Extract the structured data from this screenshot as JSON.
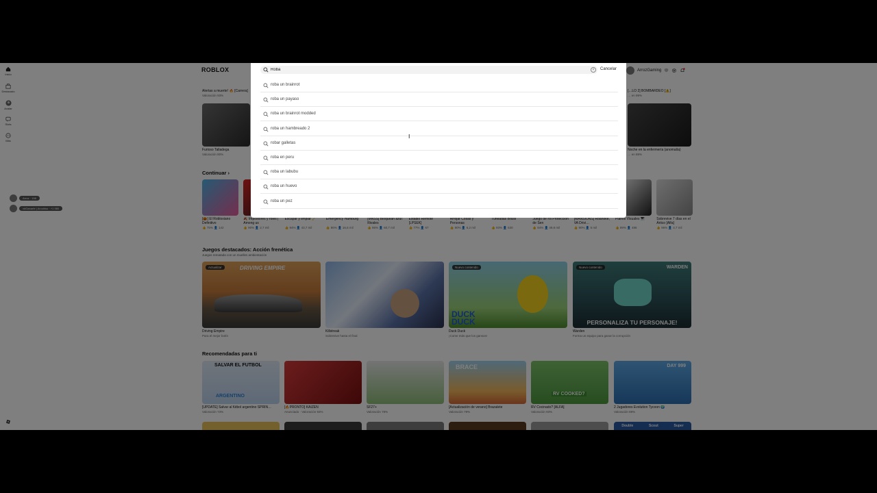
{
  "brand": {
    "logo": "ROBLOX"
  },
  "nav": {
    "items": [
      {
        "label": "Inicio"
      },
      {
        "label": "Destacado"
      },
      {
        "label": "Avatar"
      },
      {
        "label": "Slots"
      },
      {
        "label": "Más"
      }
    ]
  },
  "header": {
    "username": "ArrozGaming"
  },
  "friends": [
    {
      "name": "Arroz",
      "count": "198"
    },
    {
      "name": "xdGanarfe | Arcoiriso",
      "count": "+1 980"
    }
  ],
  "top_row": {
    "items": [
      {
        "name": "Alertas a muerte! 🔥 [Carrera]",
        "meta": "Valoración 93%"
      },
      {
        "name": "[…LO 2] BOMBARDEO [⚠️]",
        "meta": "… en 99%"
      }
    ]
  },
  "row2": {
    "items": [
      {
        "name": "Furioso Talladega",
        "meta": "Valoración 80%"
      },
      {
        "name": "Noche en la enfermería (anomalía)",
        "meta": "… en 89%"
      }
    ]
  },
  "continuar": {
    "title": "Continuar",
    "items": [
      {
        "name": "[🎃] El Robloxiano Definitivo",
        "rating": "75%",
        "players": "142"
      },
      {
        "name": "🍂 Impostores y roles | Among us",
        "rating": "90%",
        "players": "2,7 mil"
      },
      {
        "name": "Escapar y limpiar 🧹",
        "rating": "94%",
        "players": "43,7 mil"
      },
      {
        "name": "Emergency Hamburg",
        "rating": "86%",
        "players": "16,6 mil"
      },
      {
        "name": "[MNSS] Bloquean azul: Rivales",
        "rating": "96%",
        "players": "60,7 mil"
      },
      {
        "name": "Estadio Remote [LPSEK]",
        "rating": "77%",
        "players": "67"
      },
      {
        "name": "Arrojar Cosas y Personas",
        "rating": "90%",
        "players": "6,2 mil"
      },
      {
        "name": "Tuneadas Brasil",
        "rating": "93%",
        "players": "630"
      },
      {
        "name": "Juego de rol Protección de Sen",
        "rating": "84%",
        "players": "49,8 mil"
      },
      {
        "name": "[MANSIONS] Roanoke, VA Drivi…",
        "rating": "90%",
        "players": "5 mil"
      },
      {
        "name": "Pianos Visuales 🎹",
        "rating": "89%",
        "players": "486"
      },
      {
        "name": "Sobrevive 7 días en el Ártico [Alfa]",
        "rating": "96%",
        "players": "4,7 mil"
      }
    ]
  },
  "featured": {
    "title": "Juegos destacados: Acción frenética",
    "subtitle": "Juegos rematada con un muelles ambientación",
    "items": [
      {
        "badge": "Actualizar",
        "name": "Driving Empire",
        "desc": "Para el mejor botín",
        "art": "DRIVING EMPIRE"
      },
      {
        "badge": "",
        "name": "Killstreak",
        "desc": "Sobrevive hasta el final",
        "art": ""
      },
      {
        "badge": "Nuevo contenido",
        "name": "Duck Duck",
        "desc": "¡Come más que los gansos!",
        "art": "DUCK DUCK"
      },
      {
        "badge": "Nuevo contenido",
        "name": "Warden",
        "desc": "Forma un equipo para ganar la corrupción",
        "art": "PERSONALIZA TU PERSONAJE!",
        "art2": "WARDEN"
      }
    ]
  },
  "recommended": {
    "title": "Recomendadas para ti",
    "items": [
      {
        "name": "[UPDATE] Salvar al fútbol argentino SPRIN…",
        "meta": "Valoración 73%",
        "art": "SALVAR EL FUTBOL",
        "art2": "ARGENTINO"
      },
      {
        "name": "[🔥PRONTO] KAIZEN",
        "meta": "Anunciado · Valoración 93%",
        "art": ""
      },
      {
        "name": "SF27+",
        "meta": "Valoración 78%",
        "art": ""
      },
      {
        "name": "[Actualización de verano] Brazalete",
        "meta": "Valoración 79%",
        "art": "BRACE"
      },
      {
        "name": "RV Cocinado? [ALFA]",
        "meta": "Valoración 93%",
        "art": "RV COOKED?"
      },
      {
        "name": "2 Jugadores Evolution Tycoon 🌍",
        "meta": "Valoración 89%",
        "art": "DAY 999"
      }
    ]
  },
  "bottom_row": {
    "labels": [
      "Double",
      "Scout",
      "Super"
    ]
  },
  "search": {
    "query": "Roba",
    "cancel_label": "Cancelar",
    "suggestions": [
      "roba un brainrot",
      "roba un payaso",
      "roba un brainrot modded",
      "roba un hambreado 2",
      "robar galletas",
      "roba en peru",
      "roba un labubu",
      "roba un huevo",
      "roba un pez"
    ]
  }
}
